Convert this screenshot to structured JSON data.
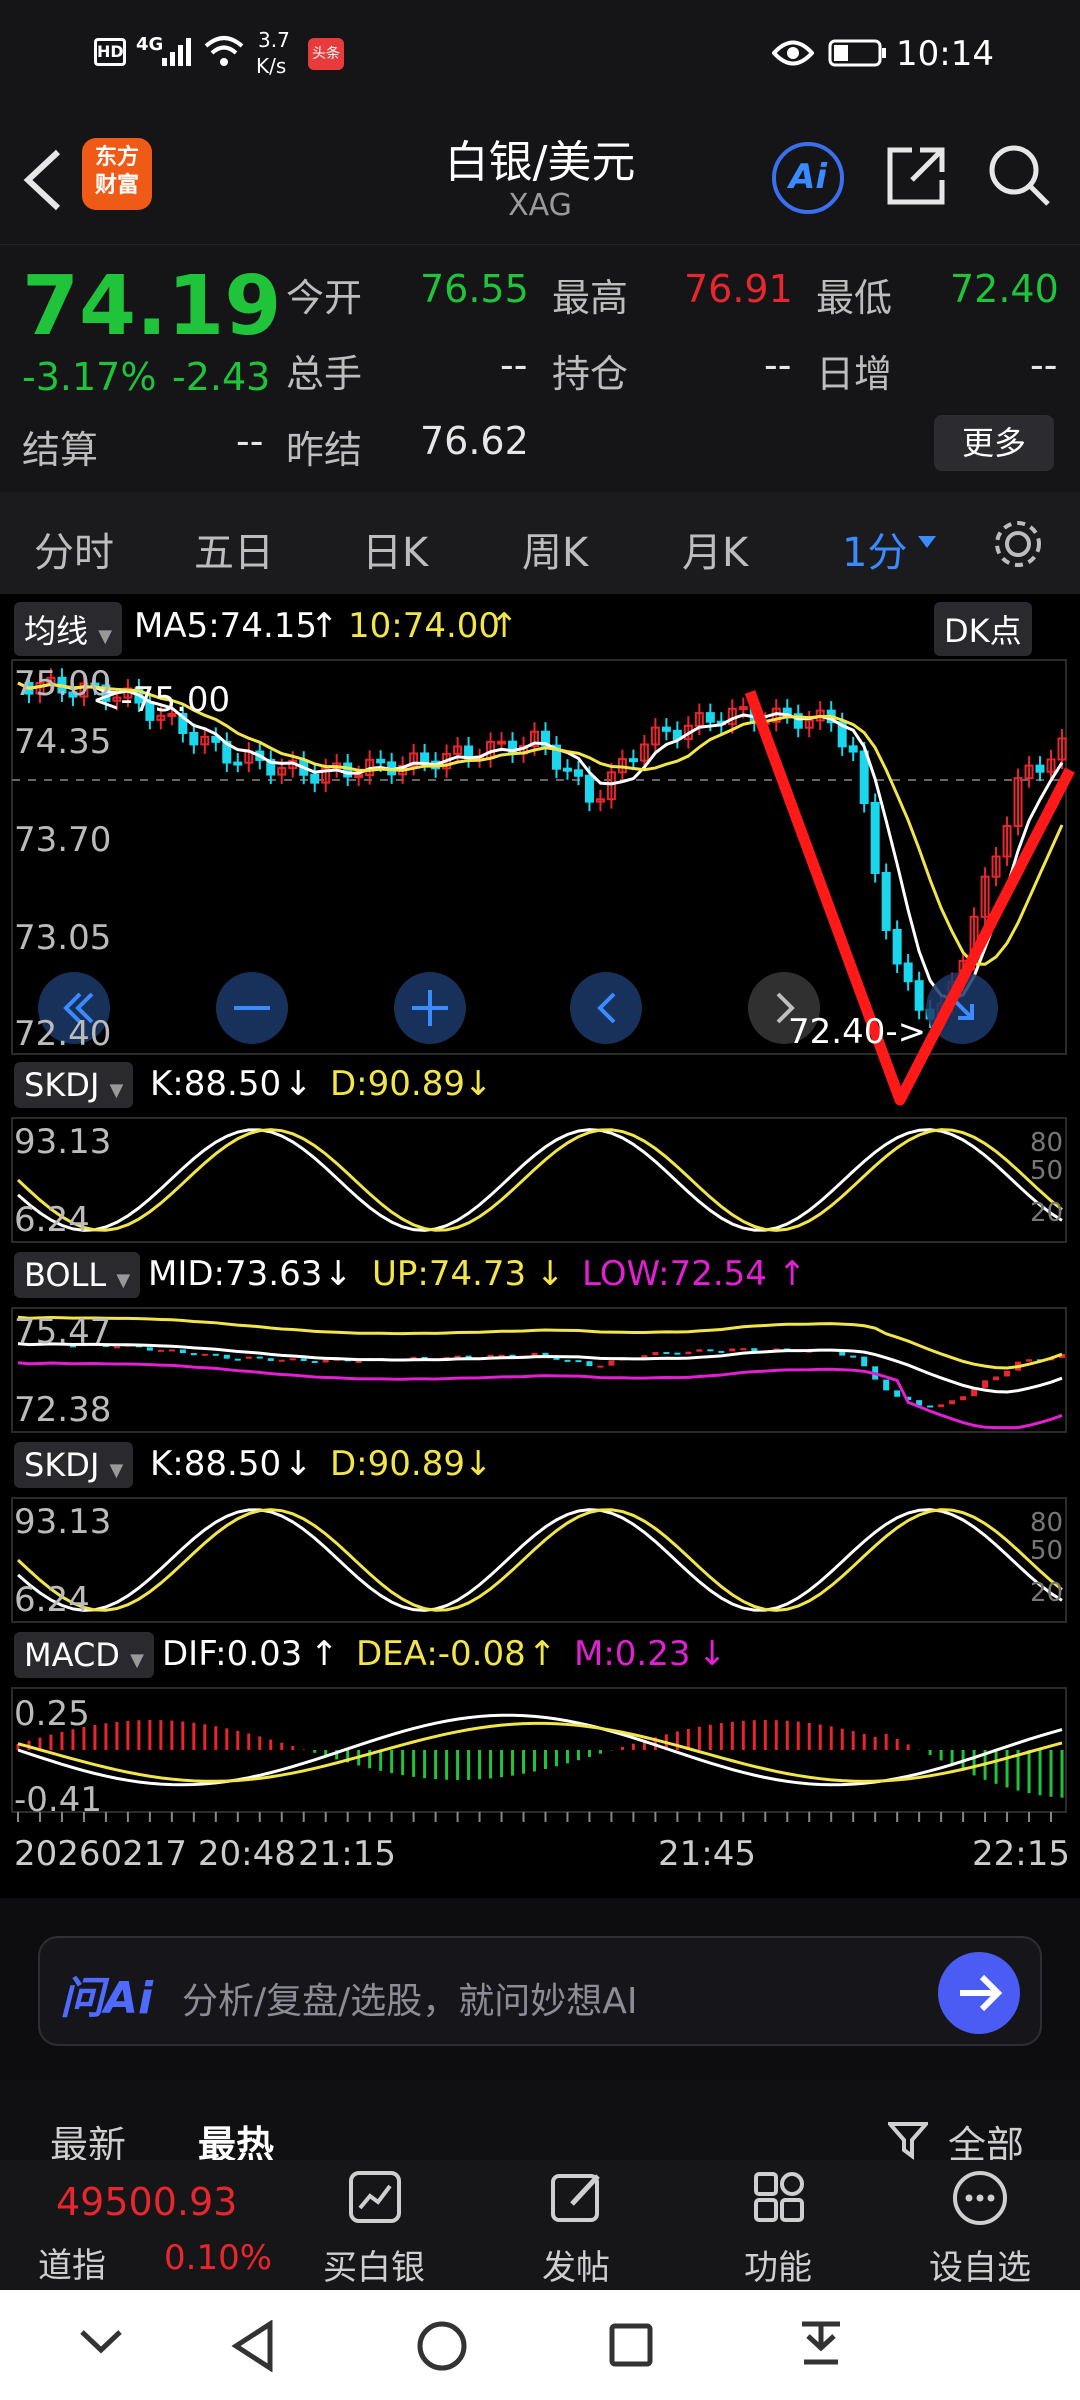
{
  "status_bar": {
    "network": "4G",
    "speed_value": "3.7",
    "speed_unit": "K/s",
    "badge": "头条",
    "time": "10:14"
  },
  "header": {
    "logo_line1": "东方",
    "logo_line2": "财富",
    "title": "白银/美元",
    "subtitle": "XAG",
    "ai_label": "Ai"
  },
  "quote": {
    "price": "74.19",
    "change_pct": "-3.17%",
    "change": "-2.43",
    "open_label": "今开",
    "open": "76.55",
    "high_label": "最高",
    "high": "76.91",
    "low_label": "最低",
    "low": "72.40",
    "volume_label": "总手",
    "volume": "--",
    "position_label": "持仓",
    "position": "--",
    "daily_inc_label": "日增",
    "daily_inc": "--",
    "settle_label": "结算",
    "settle": "--",
    "prev_settle_label": "昨结",
    "prev_settle": "76.62",
    "more_label": "更多"
  },
  "tabs": [
    "分时",
    "五日",
    "日K",
    "周K",
    "月K",
    "1分"
  ],
  "active_tab": "1分",
  "chart": {
    "ma_pill": "均线",
    "ma5": "MA5:74.15",
    "ma10": "10:74.00",
    "dk_label": "DK点",
    "price_ticks": [
      "75.00",
      "74.35",
      "73.70",
      "73.05",
      "72.40"
    ],
    "high_annot": "<-75.00",
    "low_annot": "72.40->",
    "skdj_pill": "SKDJ",
    "skdj_k": "K:88.50",
    "skdj_d": "D:90.89",
    "skdj_ticks": [
      "93.13",
      "6.24"
    ],
    "skdj_levels": [
      "80",
      "50",
      "20"
    ],
    "boll_pill": "BOLL",
    "boll_mid": "MID:73.63",
    "boll_up": "UP:74.73",
    "boll_low": "LOW:72.54",
    "boll_ticks": [
      "75.47",
      "72.38"
    ],
    "macd_pill": "MACD",
    "macd_dif": "DIF:0.03",
    "macd_dea": "DEA:-0.08",
    "macd_m": "M:0.23",
    "macd_ticks": [
      "0.25",
      "-0.41"
    ],
    "time_labels": [
      "20260217 20:48",
      "21:15",
      "21:45",
      "22:15"
    ]
  },
  "ai_bar": {
    "brand": "问Ai",
    "placeholder": "分析/复盘/选股，就问妙想AI"
  },
  "news_tabs": {
    "latest": "最新",
    "hot": "最热",
    "all": "全部"
  },
  "bottom_nav": {
    "index_value": "49500.93",
    "index_name": "道指",
    "index_change": "0.10%",
    "buy": "买白银",
    "post": "发帖",
    "func": "功能",
    "watch": "设自选"
  },
  "colors": {
    "up": "#e8262d",
    "down": "#1fc43b",
    "accent": "#3a8bff",
    "ma10": "#f2e54a",
    "low_band": "#e21fd3",
    "cyan": "#1ad7ee"
  }
}
